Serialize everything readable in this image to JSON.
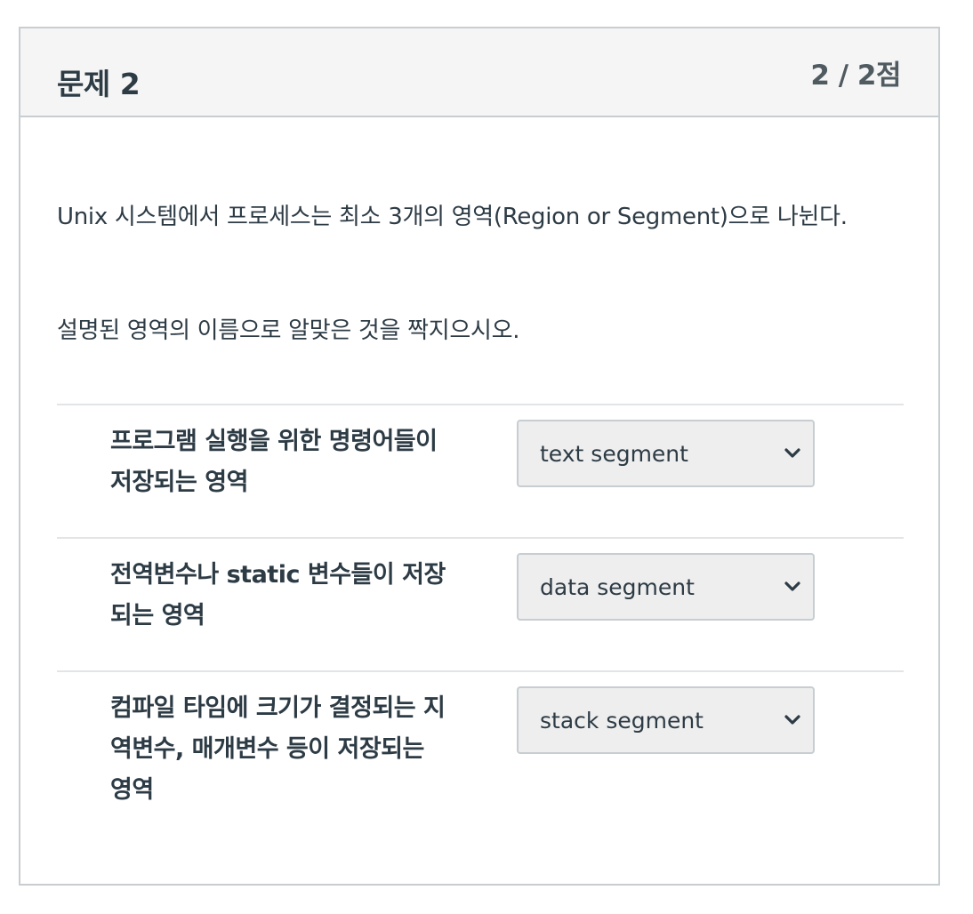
{
  "header": {
    "title": "문제 2",
    "points": "2 / 2점"
  },
  "question": {
    "line1": "Unix 시스템에서 프로세스는 최소 3개의 영역(Region or Segment)으로 나뉜다.",
    "line2": "설명된 영역의 이름으로 알맞은 것을 짝지으시오."
  },
  "answers": [
    {
      "label": "프로그램 실행을 위한 명령어들이 저장되는 영역",
      "selected": "text segment",
      "icon": "chevron-down-icon"
    },
    {
      "label": "전역변수나 static 변수들이 저장되는 영역",
      "selected": "data segment",
      "icon": "chevron-down-icon"
    },
    {
      "label": "컴파일 타임에 크기가 결정되는 지역변수, 매개변수 등이 저장되는 영역",
      "selected": "stack segment",
      "icon": "chevron-down-icon"
    }
  ],
  "colors": {
    "text": "#2d3b45",
    "border": "#c7cdd1",
    "header_bg": "#f5f5f5",
    "select_bg": "#eeeeee"
  }
}
